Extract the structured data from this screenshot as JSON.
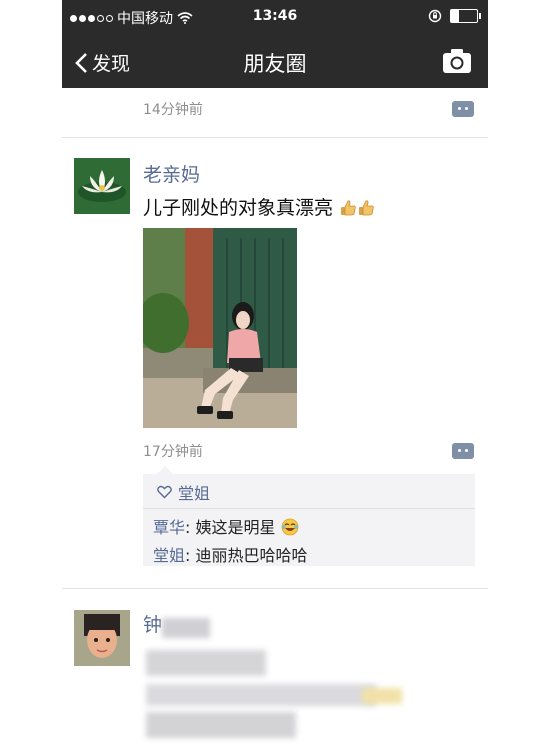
{
  "status_bar": {
    "carrier": "中国移动",
    "time": "13:46"
  },
  "nav": {
    "back_label": "发现",
    "title": "朋友圈"
  },
  "top_post": {
    "time": "14分钟前"
  },
  "post": {
    "username": "老亲妈",
    "text": "儿子刚处的对象真漂亮",
    "time": "17分钟前",
    "likes": "堂姐",
    "comments": [
      {
        "author": "覃华",
        "text": ": 姨这是明星"
      },
      {
        "author": "堂姐",
        "text": ": 迪丽热巴哈哈哈"
      }
    ]
  },
  "next_post": {
    "username": "钟"
  },
  "colors": {
    "nav_bg": "#2b2b2b",
    "link": "#576b95",
    "accent_green": "#3a6b3f"
  }
}
